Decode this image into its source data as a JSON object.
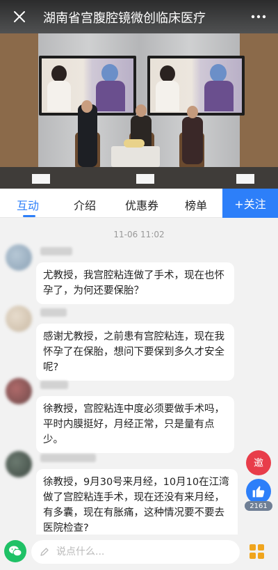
{
  "header": {
    "title": "湖南省宫腹腔镜微创临床医疗",
    "close_icon": "close-icon",
    "more_icon": "more-dots-icon"
  },
  "tabs": [
    {
      "label": "互动",
      "active": true
    },
    {
      "label": "介绍",
      "active": false
    },
    {
      "label": "优惠券",
      "active": false
    },
    {
      "label": "榜单",
      "active": false
    }
  ],
  "follow_label": "+关注",
  "chat": {
    "timestamp": "11-06 11:02",
    "messages": [
      {
        "text": "尤教授，我宫腔粘连做了手术，现在也怀孕了，为何还要保胎？"
      },
      {
        "text": "感谢尤教授，之前患有宫腔粘连，现在我怀孕了在保胎，想问下要保到多久才安全呢?"
      },
      {
        "text": "徐教授，宫腔粘连中度必须要做手术吗，平时内膜挺好，月经正常，只是量有点少。"
      },
      {
        "text": "徐教授，9月30号来月经，10月10在江湾做了宫腔粘连手术，现在还没有来月经，有多囊，现在有胀痛，这种情况要不要去医院检查?"
      }
    ]
  },
  "invite_label": "邀",
  "like_count": "2161",
  "input": {
    "placeholder": "说点什么..."
  },
  "colors": {
    "accent": "#2d7ff9",
    "invite": "#e83d4a",
    "wechat": "#1fc166",
    "grid": "#f0a51d"
  }
}
